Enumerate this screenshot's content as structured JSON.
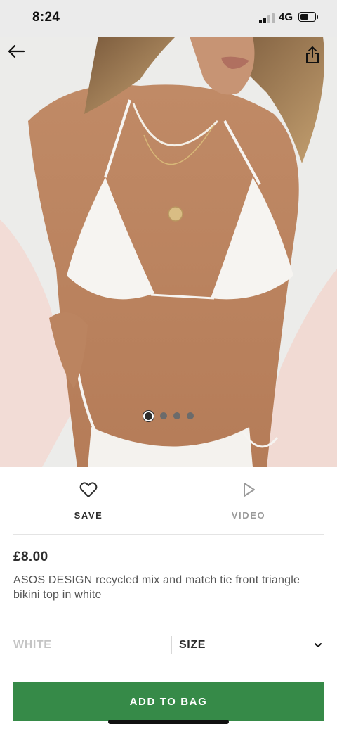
{
  "status_bar": {
    "time": "8:24",
    "network": "4G",
    "signal_bars_filled": 2,
    "signal_bars_total": 4,
    "battery_level": 0.6
  },
  "gallery": {
    "image_count": 4,
    "active_index": 0,
    "back_icon": "arrow-left-icon",
    "share_icon": "share-icon"
  },
  "actions": {
    "save_label": "SAVE",
    "save_icon": "heart-icon",
    "video_label": "VIDEO",
    "video_icon": "play-icon"
  },
  "product": {
    "price": "£8.00",
    "title": "ASOS DESIGN recycled mix and match tie front triangle bikini top in white"
  },
  "selectors": {
    "color": "WHITE",
    "size": "SIZE"
  },
  "add_to_bag": {
    "label": "ADD TO BAG"
  },
  "colors": {
    "primary_button": "#368a48",
    "text_dark": "#2d2d2d",
    "text_muted": "#9a9a9a"
  }
}
